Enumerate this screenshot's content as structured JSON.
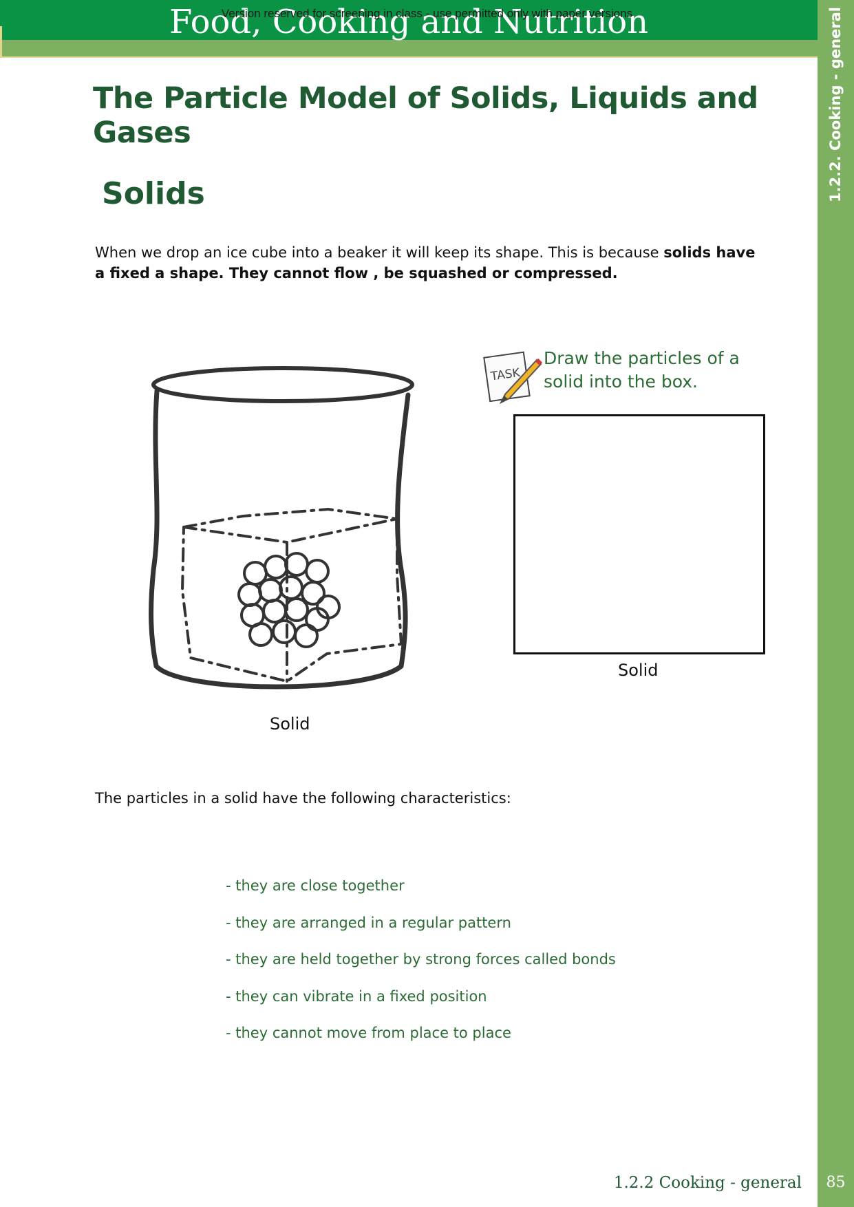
{
  "header": {
    "book_title": "Food, Cooking and Nutrition",
    "watermark": "Version reserved for screening in class - use permitted only with paper versions"
  },
  "side_tab": {
    "label": "1.2.2.  Cooking - general"
  },
  "page": {
    "title": "The Particle Model of Solids, Liquids and Gases",
    "section_heading": "Solids",
    "intro_plain": "When we drop an ice cube into a beaker it will keep its shape. This is because ",
    "intro_bold": "solids have a fixed a shape. They cannot flow , be squashed or compressed.",
    "figure_caption_left": "Solid",
    "task_icon_label": "TASK",
    "task_text": "Draw the particles of a solid into the box.",
    "box_caption": "Solid",
    "characteristics_lead": "The particles in a solid have the following characteristics:",
    "characteristics": [
      "- they are close together",
      "- they are arranged in a regular pattern",
      "- they are held together by strong forces called bonds",
      "- they can vibrate in a fixed position",
      "- they cannot move from place to place"
    ]
  },
  "footer": {
    "section": "1.2.2 Cooking - general",
    "page_number": "85"
  },
  "colors": {
    "header_green": "#0b9345",
    "sidebar_green": "#7eb061",
    "heading_green": "#1f5a33",
    "list_green": "#2b6b34"
  }
}
